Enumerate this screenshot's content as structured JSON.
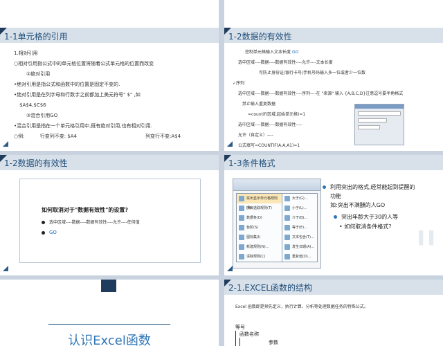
{
  "slide1": {
    "title": "1-1单元格的引用",
    "lines": [
      "1.相对引用",
      "○相对引用指公式中的单元格位置将随着公式单元格的位置而改变",
      "②绝对引用",
      "•绝对引用是指公式和函数中的位置是固定不变的.",
      "•绝对引用是在列字母和行数字之前都加上美元符号\" $\" ,如",
      "$A$4,$C$6",
      "③混合引用GO",
      "•混合引用是指在一个单元格引用中,既有绝对引用,也有相对引用."
    ],
    "example_label": "○例:",
    "example_left": "行变列不变: $A4",
    "example_right": "列变行不变:A$4"
  },
  "slide2": {
    "title": "1-2数据的有效性",
    "lines": [
      "控制单元格输入文本长度",
      "选中区域----数据----数据有效性----允许----文本长度",
      "可防止身份证/银行卡号/手机号码输入多一位或者少一位数",
      "✓序列",
      "选中区域----数据----数据有效性----序列----在 \"来源\" 输入 {A,B,C,D}注意逗号要半角格式",
      "禁止输入重复数据",
      "=countif(区域,起始单元格)=1",
      "选中区域----数据----数据有效性----",
      "允许（自定义）----",
      "公式填写=COUNTIF(A:A,A1)=1"
    ],
    "go_label": "GO"
  },
  "slide3": {
    "title": "1-2数据的有效性",
    "question": "如何取消对于\"数据有效性\"的设置?",
    "item1": "选中区域----数据----数据有效性----允许----任何值",
    "item2": "GO"
  },
  "slide4": {
    "title": "1-3条件格式",
    "bullet1": "利用突出的格式,经常能起到提醒的",
    "bullet1b": "功能",
    "example": "如:突出不满酬的人GO",
    "sub1": "突出年龄大于30的人等",
    "sub2": "如何取消条件格式?",
    "menu_items": [
      "突出显示单元格规则(H)",
      "项目选取规则(T)",
      "数据条(D)",
      "色阶(S)",
      "图标集(I)",
      "新建规则(N)...",
      "清除规则(C)",
      "管理规则(R)..."
    ],
    "submenu_items": [
      "大于(G)...",
      "小于(L)...",
      "介于(B)...",
      "等于(E)...",
      "文本包含(T)...",
      "发生日期(A)...",
      "重复值(D)...",
      "其他规则(M)..."
    ]
  },
  "slide5": {
    "title": "认识Excel函数"
  },
  "slide6": {
    "title": "2-1.EXCEL函数的结构",
    "desc": "Excel 函数即是预先定义，执行计算、分析等处理数据任务的特殊公式。",
    "diagram": {
      "label1": "等号",
      "label2": "函数名称",
      "label3": "参数"
    }
  },
  "colors": {
    "accent": "#1f4e79",
    "titlebar": "#d8e1ea",
    "background": "#c9d3df"
  }
}
